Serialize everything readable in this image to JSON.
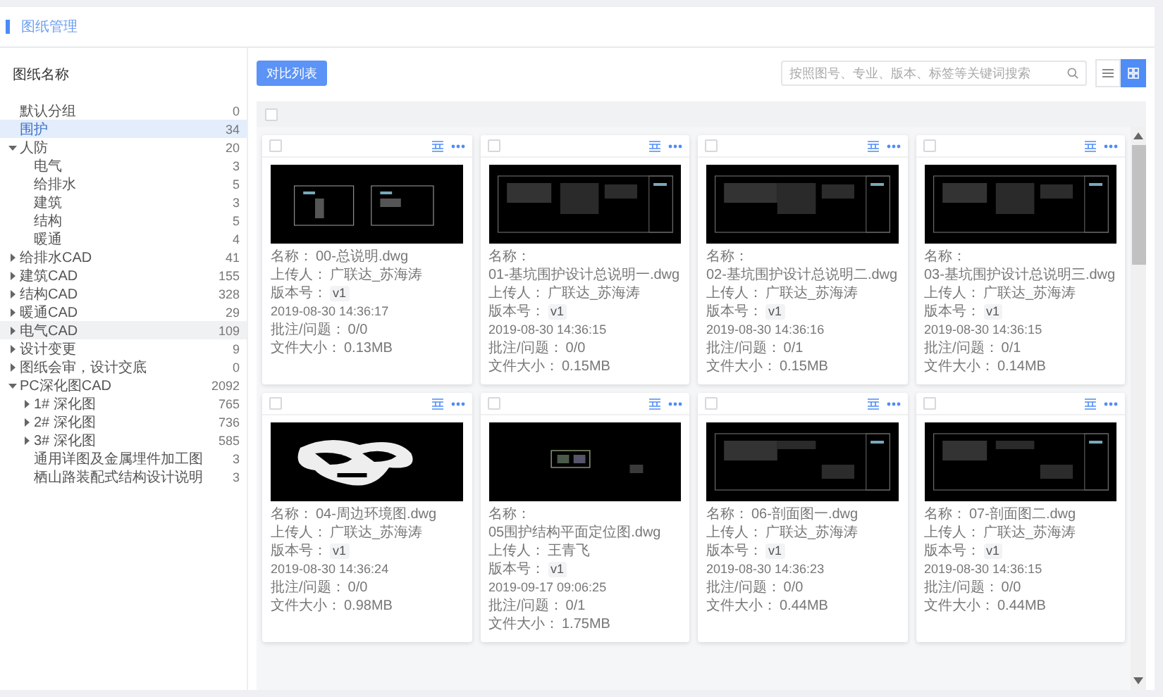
{
  "header": {
    "title": "图纸管理"
  },
  "sidebar": {
    "title": "图纸名称",
    "items": [
      {
        "label": "默认分组",
        "count": "0",
        "selected": false
      },
      {
        "label": "围护",
        "count": "34",
        "selected": true
      },
      {
        "label": "人防",
        "count": "20",
        "selected": false,
        "expanded": true,
        "children": [
          {
            "label": "电气",
            "count": "3",
            "selected": false
          },
          {
            "label": "给排水",
            "count": "5",
            "selected": false
          },
          {
            "label": "建筑",
            "count": "3",
            "selected": false
          },
          {
            "label": "结构",
            "count": "5",
            "selected": false
          },
          {
            "label": "暖通",
            "count": "4",
            "selected": false
          }
        ]
      },
      {
        "label": "给排水CAD",
        "count": "41",
        "selected": false,
        "expanded": false
      },
      {
        "label": "建筑CAD",
        "count": "155",
        "selected": false,
        "expanded": false
      },
      {
        "label": "结构CAD",
        "count": "328",
        "selected": false,
        "expanded": false
      },
      {
        "label": "暖通CAD",
        "count": "29",
        "selected": false,
        "expanded": false
      },
      {
        "label": "电气CAD",
        "count": "109",
        "selected": false,
        "hovered": true,
        "expanded": false
      },
      {
        "label": "设计变更",
        "count": "9",
        "selected": false,
        "expanded": false
      },
      {
        "label": "图纸会审，设计交底",
        "count": "0",
        "selected": false,
        "expanded": false
      },
      {
        "label": "PC深化图CAD",
        "count": "2092",
        "selected": false,
        "expanded": true,
        "children": [
          {
            "label": "1# 深化图",
            "count": "765",
            "selected": false,
            "expanded": false
          },
          {
            "label": "2# 深化图",
            "count": "736",
            "selected": false,
            "expanded": false
          },
          {
            "label": "3# 深化图",
            "count": "585",
            "selected": false,
            "expanded": false
          },
          {
            "label": "通用详图及金属埋件加工图",
            "count": "3",
            "selected": false
          },
          {
            "label": "栖山路装配式结构设计说明",
            "count": "3",
            "selected": false
          }
        ]
      }
    ]
  },
  "toolbar": {
    "button": "对比列表",
    "search": {
      "placeholder": "按照图号、专业、版本、标签等关键词搜索"
    },
    "views": [
      {
        "kind": "list",
        "selected": false
      },
      {
        "kind": "grid",
        "selected": true
      }
    ]
  },
  "select_all": {
    "checked": false
  },
  "cards": [
    {
      "checked": false,
      "fields": [
        {
          "label": "名称：",
          "value": "00-总说明.dwg"
        },
        {
          "label": "上传人：",
          "value": "广联达_苏海涛"
        },
        {
          "label": "版本号：",
          "badge": "v1",
          "value": "2019-08-30 14:36:17"
        },
        {
          "label": "批注/问题：",
          "value": "0/0"
        },
        {
          "label": "文件大小：",
          "value": "0.13MB"
        }
      ]
    },
    {
      "checked": false,
      "fields": [
        {
          "label": "名称：",
          "value": "01-基坑围护设计总说明一.dwg"
        },
        {
          "label": "上传人：",
          "value": "广联达_苏海涛"
        },
        {
          "label": "版本号：",
          "badge": "v1",
          "value": "2019-08-30 14:36:15"
        },
        {
          "label": "批注/问题：",
          "value": "0/0"
        },
        {
          "label": "文件大小：",
          "value": "0.15MB"
        }
      ]
    },
    {
      "checked": false,
      "fields": [
        {
          "label": "名称：",
          "value": "02-基坑围护设计总说明二.dwg"
        },
        {
          "label": "上传人：",
          "value": "广联达_苏海涛"
        },
        {
          "label": "版本号：",
          "badge": "v1",
          "value": "2019-08-30 14:36:16"
        },
        {
          "label": "批注/问题：",
          "value": "0/1"
        },
        {
          "label": "文件大小：",
          "value": "0.15MB"
        }
      ]
    },
    {
      "checked": false,
      "fields": [
        {
          "label": "名称：",
          "value": "03-基坑围护设计总说明三.dwg"
        },
        {
          "label": "上传人：",
          "value": "广联达_苏海涛"
        },
        {
          "label": "版本号：",
          "badge": "v1",
          "value": "2019-08-30 14:36:15"
        },
        {
          "label": "批注/问题：",
          "value": "0/1"
        },
        {
          "label": "文件大小：",
          "value": "0.14MB"
        }
      ]
    },
    {
      "checked": false,
      "fields": [
        {
          "label": "名称：",
          "value": "04-周边环境图.dwg"
        },
        {
          "label": "上传人：",
          "value": "广联达_苏海涛"
        },
        {
          "label": "版本号：",
          "badge": "v1",
          "value": "2019-08-30 14:36:24"
        },
        {
          "label": "批注/问题：",
          "value": "0/0"
        },
        {
          "label": "文件大小：",
          "value": "0.98MB"
        }
      ]
    },
    {
      "checked": false,
      "fields": [
        {
          "label": "名称：",
          "value": "05围护结构平面定位图.dwg"
        },
        {
          "label": "上传人：",
          "value": "王青飞"
        },
        {
          "label": "版本号：",
          "badge": "v1",
          "value": "2019-09-17 09:06:25"
        },
        {
          "label": "批注/问题：",
          "value": "0/1"
        },
        {
          "label": "文件大小：",
          "value": "1.75MB"
        }
      ]
    },
    {
      "checked": false,
      "fields": [
        {
          "label": "名称：",
          "value": "06-剖面图一.dwg"
        },
        {
          "label": "上传人：",
          "value": "广联达_苏海涛"
        },
        {
          "label": "版本号：",
          "badge": "v1",
          "value": "2019-08-30 14:36:23"
        },
        {
          "label": "批注/问题：",
          "value": "0/0"
        },
        {
          "label": "文件大小：",
          "value": "0.44MB"
        }
      ]
    },
    {
      "checked": false,
      "fields": [
        {
          "label": "名称：",
          "value": "07-剖面图二.dwg"
        },
        {
          "label": "上传人：",
          "value": "广联达_苏海涛"
        },
        {
          "label": "版本号：",
          "badge": "v1",
          "value": "2019-08-30 14:36:15"
        },
        {
          "label": "批注/问题：",
          "value": "0/0"
        },
        {
          "label": "文件大小：",
          "value": "0.44MB"
        }
      ]
    }
  ]
}
